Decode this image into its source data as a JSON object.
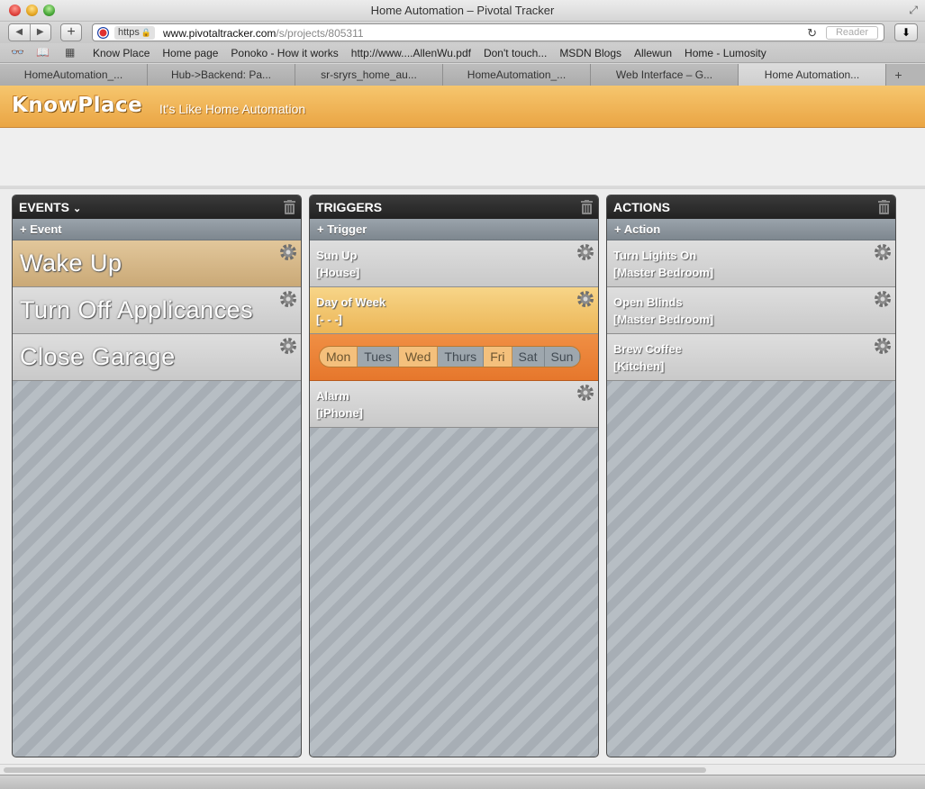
{
  "window": {
    "title": "Home Automation – Pivotal Tracker"
  },
  "toolbar": {
    "url_protocol": "https",
    "url_host": "www.pivotaltracker.com",
    "url_path": "/s/projects/805311",
    "reader_label": "Reader"
  },
  "bookmarks": [
    "Know Place",
    "Home page",
    "Ponoko - How it works",
    "http://www....AllenWu.pdf",
    "Don't touch...",
    "MSDN Blogs",
    "Allewun",
    "Home - Lumosity"
  ],
  "tabs": [
    {
      "label": "HomeAutomation_..."
    },
    {
      "label": "Hub->Backend: Pa..."
    },
    {
      "label": "sr-sryrs_home_au..."
    },
    {
      "label": "HomeAutomation_..."
    },
    {
      "label": "Web Interface – G..."
    },
    {
      "label": "Home Automation..."
    }
  ],
  "app": {
    "logo": "KnowPlace",
    "tagline": "It's Like Home Automation"
  },
  "events": {
    "title": "EVENTS",
    "add_label": "+ Event",
    "items": [
      "Wake Up",
      "Turn Off Applicances",
      "Close Garage"
    ]
  },
  "triggers": {
    "title": "TRIGGERS",
    "add_label": "+ Trigger",
    "items": [
      {
        "name": "Sun Up",
        "detail": "[House]"
      },
      {
        "name": "Day of Week",
        "detail": "[- - -]"
      },
      {
        "name": "Alarm",
        "detail": "[iPhone]"
      }
    ],
    "days": [
      {
        "label": "Mon",
        "selected": false
      },
      {
        "label": "Tues",
        "selected": true
      },
      {
        "label": "Wed",
        "selected": false
      },
      {
        "label": "Thurs",
        "selected": true
      },
      {
        "label": "Fri",
        "selected": false
      },
      {
        "label": "Sat",
        "selected": true
      },
      {
        "label": "Sun",
        "selected": true
      }
    ]
  },
  "actions": {
    "title": "ACTIONS",
    "add_label": "+ Action",
    "items": [
      {
        "name": "Turn Lights On",
        "detail": "[Master Bedroom]"
      },
      {
        "name": "Open Blinds",
        "detail": "[Master Bedroom]"
      },
      {
        "name": "Brew Coffee",
        "detail": "[Kitchen]"
      }
    ]
  },
  "colors": {
    "accent": "#eaa544",
    "selected_trigger": "#ecb657",
    "day_picker": "#e6772c"
  }
}
